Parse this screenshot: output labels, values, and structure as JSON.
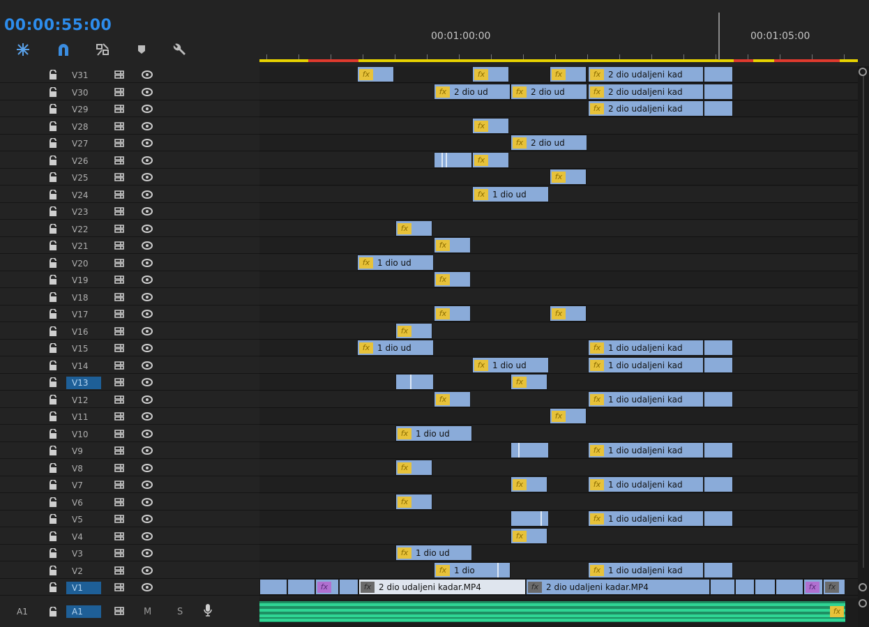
{
  "timecode": "00:00:55:00",
  "ruler": {
    "labels": [
      "00:01:00:00",
      "00:01:05:00"
    ]
  },
  "tracks": [
    {
      "name": "V31",
      "selected": false
    },
    {
      "name": "V30",
      "selected": false
    },
    {
      "name": "V29",
      "selected": false
    },
    {
      "name": "V28",
      "selected": false
    },
    {
      "name": "V27",
      "selected": false
    },
    {
      "name": "V26",
      "selected": false
    },
    {
      "name": "V25",
      "selected": false
    },
    {
      "name": "V24",
      "selected": false
    },
    {
      "name": "V23",
      "selected": false
    },
    {
      "name": "V22",
      "selected": false
    },
    {
      "name": "V21",
      "selected": false
    },
    {
      "name": "V20",
      "selected": false
    },
    {
      "name": "V19",
      "selected": false
    },
    {
      "name": "V18",
      "selected": false
    },
    {
      "name": "V17",
      "selected": false
    },
    {
      "name": "V16",
      "selected": false
    },
    {
      "name": "V15",
      "selected": false
    },
    {
      "name": "V14",
      "selected": false
    },
    {
      "name": "V13",
      "selected": true
    },
    {
      "name": "V12",
      "selected": false
    },
    {
      "name": "V11",
      "selected": false
    },
    {
      "name": "V10",
      "selected": false
    },
    {
      "name": "V9",
      "selected": false
    },
    {
      "name": "V8",
      "selected": false
    },
    {
      "name": "V7",
      "selected": false
    },
    {
      "name": "V6",
      "selected": false
    },
    {
      "name": "V5",
      "selected": false
    },
    {
      "name": "V4",
      "selected": false
    },
    {
      "name": "V3",
      "selected": false
    },
    {
      "name": "V2",
      "selected": false
    },
    {
      "name": "V1",
      "selected": true
    }
  ],
  "audio_track": {
    "source_label": "A1",
    "name": "A1",
    "mute": "M",
    "solo": "S"
  },
  "fx_label": "fx",
  "clip_labels": {
    "c1": "2 dio ud",
    "c2": "2 dio udaljeni kad",
    "c3": "1 dio ud",
    "c4": "1 dio udaljeni kad",
    "c5": "1 dio",
    "c6": "2 dio udaljeni kadar.MP4"
  },
  "colors": {
    "timecode": "#2d8ceb",
    "clip": "#8aabd9",
    "fx": "#e7c23a",
    "audio": "#1e8f63",
    "selected_track": "#1e5f97"
  }
}
